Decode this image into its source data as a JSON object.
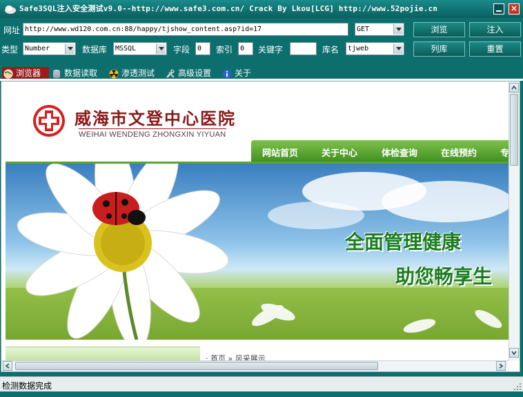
{
  "window": {
    "title": "Safe3SQL注入安全测试v9.0--http://www.safe3.com.cn/   Crack By Lkou[LCG]  http://www.52pojie.cn",
    "minimize_label": "–",
    "close_label": "×"
  },
  "toolbar": {
    "url_label": "网址",
    "url_value": "http://www.wd120.com.cn:88/happy/tjshow_content.asp?id=17",
    "method_value": "GET",
    "browse_button": "浏览",
    "inject_button": "注入",
    "type_label": "类型",
    "type_value": "Number",
    "db_label": "数据库",
    "db_value": "MSSQL",
    "field_label": "字段",
    "field_value": "0",
    "index_label": "索引",
    "index_value": "0",
    "keyword_label": "关键字",
    "keyword_value": "",
    "dbname_label": "库名",
    "dbname_value": "tjweb",
    "list_button": "列库",
    "reset_button": "重置"
  },
  "tabs": [
    {
      "label": "浏览器",
      "icon": "globe-icon",
      "active": true
    },
    {
      "label": "数据读取",
      "icon": "database-icon",
      "active": false
    },
    {
      "label": "渗透测试",
      "icon": "radiation-icon",
      "active": false
    },
    {
      "label": "高级设置",
      "icon": "tools-icon",
      "active": false
    },
    {
      "label": "关于",
      "icon": "info-icon",
      "active": false
    }
  ],
  "webpage": {
    "hospital_name_cn": "威海市文登中心医院",
    "hospital_name_en": "WEIHAI WENDENG ZHONGXIN YIYUAN",
    "nav": [
      "网站首页",
      "关于中心",
      "体检查询",
      "在线预约",
      "专"
    ],
    "slogan_line1": "全面管理健康",
    "slogan_line2": "助您畅享生",
    "breadcrumb": "· 首页 » 风采展示"
  },
  "status": {
    "text": "检测数据完成"
  },
  "colors": {
    "frame": "#0d6e6e",
    "active_tab": "#9a1c1c",
    "nav_green": "#4f9d2c",
    "slogan_green": "#1b7c22",
    "logo_red": "#8a1818"
  }
}
